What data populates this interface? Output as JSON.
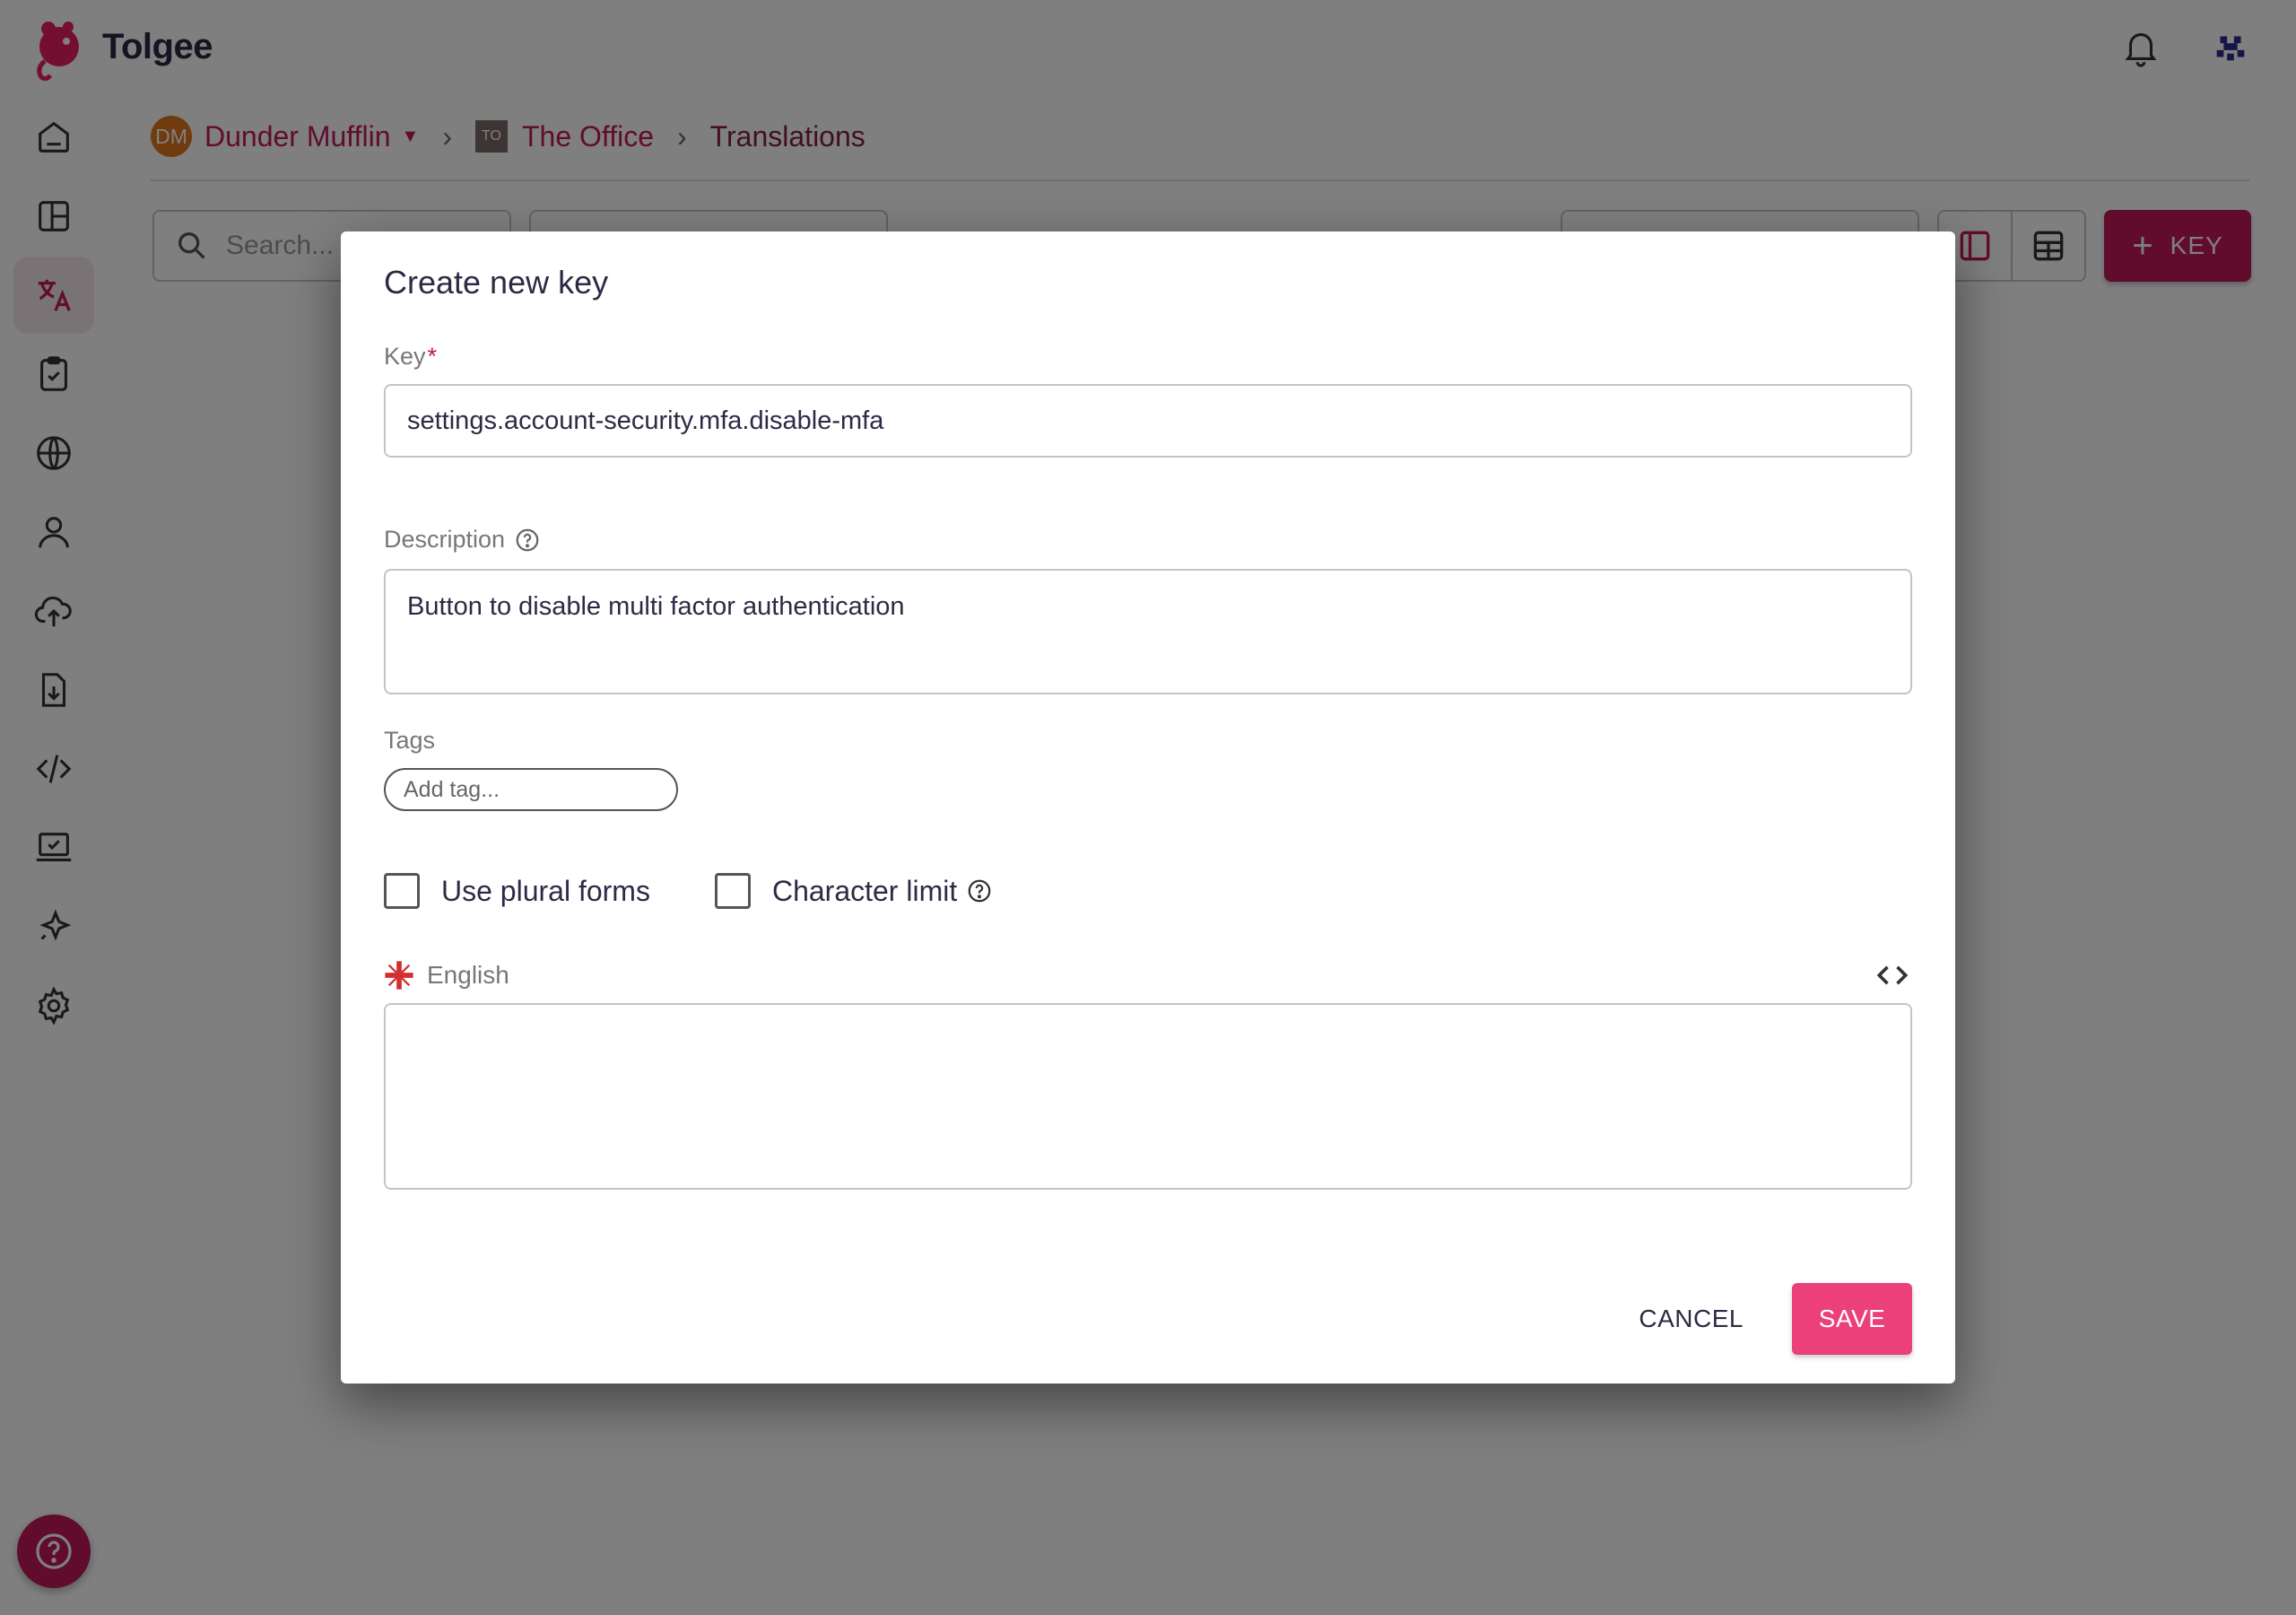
{
  "app": {
    "name": "Tolgee"
  },
  "header": {
    "icons": [
      "bell-icon",
      "user-avatar-icon"
    ]
  },
  "sidebar": {
    "items": [
      {
        "icon": "home-icon"
      },
      {
        "icon": "dashboard-icon"
      },
      {
        "icon": "translate-icon",
        "active": true
      },
      {
        "icon": "tasks-icon"
      },
      {
        "icon": "globe-icon"
      },
      {
        "icon": "user-icon"
      },
      {
        "icon": "upload-cloud-icon"
      },
      {
        "icon": "export-file-icon"
      },
      {
        "icon": "code-icon"
      },
      {
        "icon": "laptop-check-icon"
      },
      {
        "icon": "sparkle-icon"
      },
      {
        "icon": "settings-icon"
      }
    ],
    "help_icon": "help-icon"
  },
  "breadcrumb": {
    "org_initials": "DM",
    "org_name": "Dunder Mufflin",
    "project_initials": "TO",
    "project_name": "The Office",
    "page": "Translations"
  },
  "toolbar": {
    "search_placeholder": "Search...",
    "add_key_label": "KEY"
  },
  "modal": {
    "title": "Create new key",
    "key_label": "Key",
    "required_marker": "*",
    "key_value": "settings.account-security.mfa.disable-mfa",
    "description_label": "Description",
    "description_value": "Button to disable multi factor authentication",
    "tags_label": "Tags",
    "tag_placeholder": "Add tag...",
    "plural_label": "Use plural forms",
    "char_limit_label": "Character limit",
    "language": "English",
    "translation_value": "",
    "cancel_label": "CANCEL",
    "save_label": "SAVE"
  },
  "colors": {
    "brand": "#c2185b",
    "save": "#ec407a",
    "overlay": "rgba(0,0,0,0.5)"
  }
}
